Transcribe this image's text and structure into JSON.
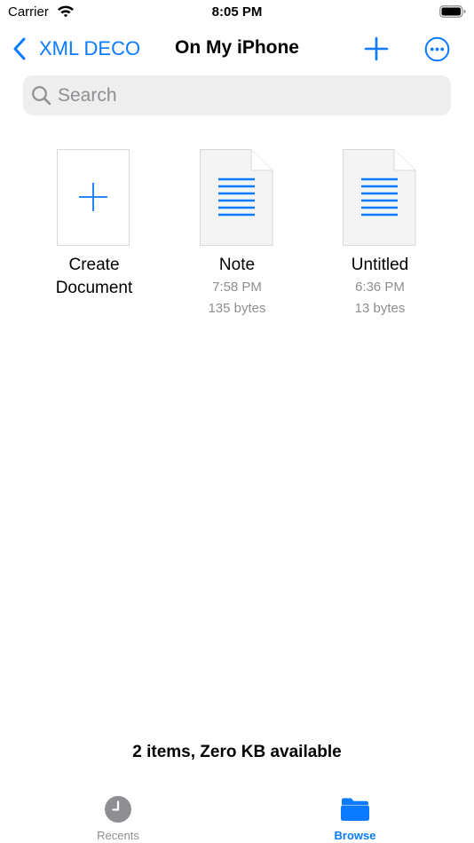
{
  "status_bar": {
    "carrier": "Carrier",
    "time": "8:05 PM"
  },
  "nav": {
    "back_label": "XML DECO",
    "title": "On My iPhone"
  },
  "search": {
    "placeholder": "Search"
  },
  "items": [
    {
      "name": "Create\nDocument",
      "icon": "plus-icon"
    },
    {
      "name": "Note",
      "time": "7:58 PM",
      "size": "135 bytes",
      "icon": "document-icon"
    },
    {
      "name": "Untitled",
      "time": "6:36 PM",
      "size": "13 bytes",
      "icon": "document-icon"
    }
  ],
  "footer": {
    "summary": "2 items, Zero KB available"
  },
  "tabs": [
    {
      "label": "Recents",
      "icon": "clock-icon",
      "selected": false
    },
    {
      "label": "Browse",
      "icon": "folder-icon",
      "selected": true
    }
  ],
  "colors": {
    "accent": "#0a7aff",
    "secondary_text": "#8e8e93",
    "search_bg": "#eeeeef"
  }
}
